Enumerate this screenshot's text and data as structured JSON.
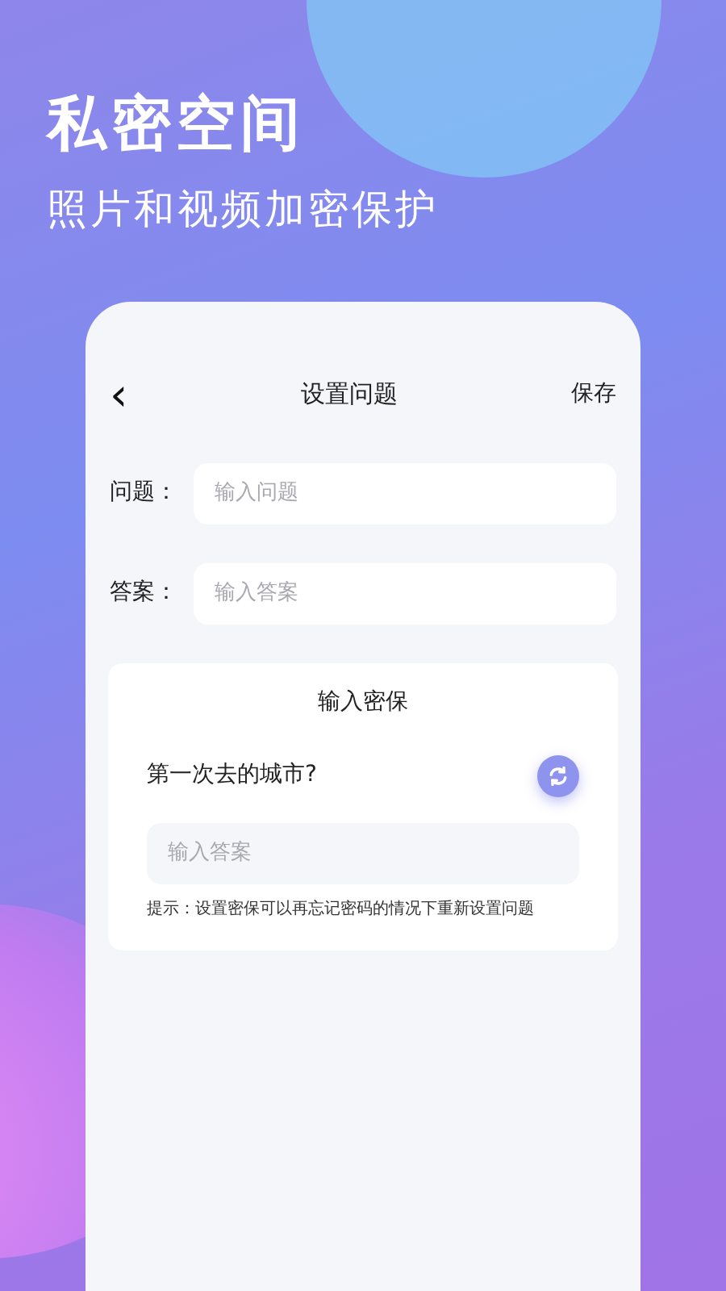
{
  "promo": {
    "title": "私密空间",
    "subtitle": "照片和视频加密保护"
  },
  "header": {
    "back": "‹",
    "title": "设置问题",
    "action": "保存"
  },
  "fields": [
    {
      "label": "问题：",
      "placeholder": "输入问题"
    },
    {
      "label": "答案：",
      "placeholder": "输入答案"
    }
  ],
  "security_card": {
    "title": "输入密保",
    "question": "第一次去的城市?",
    "answer_placeholder": "输入答案",
    "hint": "提示：设置密保可以再忘记密码的情况下重新设置问题"
  }
}
